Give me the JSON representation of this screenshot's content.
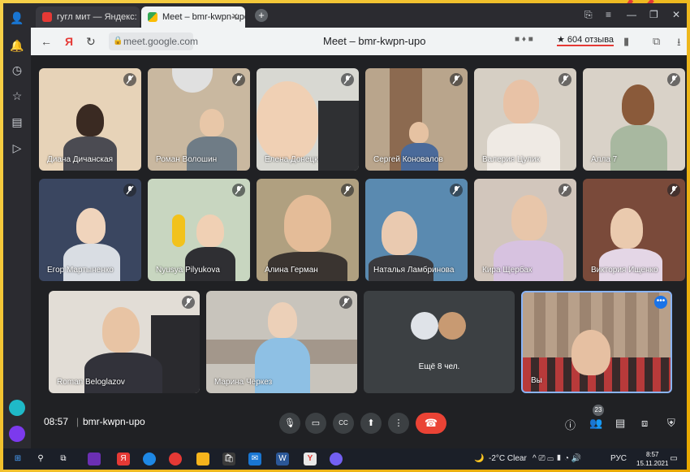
{
  "browser": {
    "tabs": [
      {
        "label": "гугл мит — Яндекс: нашло",
        "active": false
      },
      {
        "label": "Meet – bmr-kwpn-upo",
        "active": true
      }
    ],
    "url": "meet.google.com",
    "page_title": "Meet – bmr-kwpn-upo",
    "reviews": "★ 604 отзыва"
  },
  "participants": [
    {
      "name": "Диана Дичанская",
      "muted": true
    },
    {
      "name": "Роман Волошин",
      "muted": true
    },
    {
      "name": "Елена Донецк",
      "muted": true
    },
    {
      "name": "Сергей Коновалов",
      "muted": true
    },
    {
      "name": "Валерия Цулик",
      "muted": true
    },
    {
      "name": "Алла 7",
      "muted": true
    },
    {
      "name": "Егор Мартыненко",
      "muted": true
    },
    {
      "name": "Nyusya Pilyukova",
      "muted": true
    },
    {
      "name": "Алина Герман",
      "muted": true
    },
    {
      "name": "Наталья Ламбринова",
      "muted": true
    },
    {
      "name": "Кира Щербак",
      "muted": true
    },
    {
      "name": "Виктория Ищенко",
      "muted": true
    },
    {
      "name": "Roman Beloglazov",
      "muted": true
    },
    {
      "name": "Марина Черкез",
      "muted": true
    }
  ],
  "more_tile": {
    "label": "Ещё 8 чел."
  },
  "self_tile": {
    "label": "Вы",
    "menu": "•••"
  },
  "meeting_bar": {
    "time": "08:57",
    "separator": "|",
    "code": "bmr-kwpn-upo",
    "participants_count": "23"
  },
  "taskbar": {
    "weather": "-2°C Clear",
    "lang": "РУС",
    "clock_time": "8:57",
    "clock_date": "15.11.2021"
  },
  "colors": {
    "accent": "#1a73e8",
    "hangup": "#ea4335",
    "frame": "#f2c200"
  }
}
